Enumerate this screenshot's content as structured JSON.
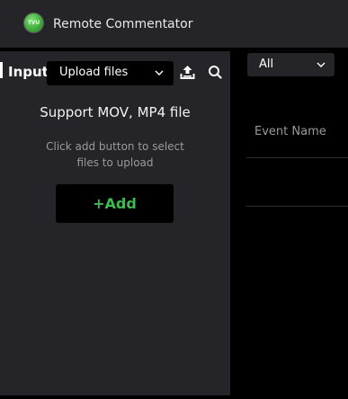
{
  "app": {
    "title": "Remote Commentator",
    "logo_text": "TVU"
  },
  "input_panel": {
    "label": "Input",
    "source_select": {
      "selected": "Upload files"
    },
    "icons": [
      "upload-icon",
      "search-icon",
      "chevron-down-icon"
    ],
    "support_text": "Support MOV, MP4 file",
    "hint_text": "Click add button to select files to upload",
    "add_button_label": "+Add"
  },
  "events_panel": {
    "filter_select": {
      "selected": "All"
    },
    "column_header": "Event Name"
  },
  "colors": {
    "panel_bg": "#252529",
    "page_bg": "#000000",
    "accent_green": "#3fb950",
    "muted_text": "#9a9a9a"
  }
}
